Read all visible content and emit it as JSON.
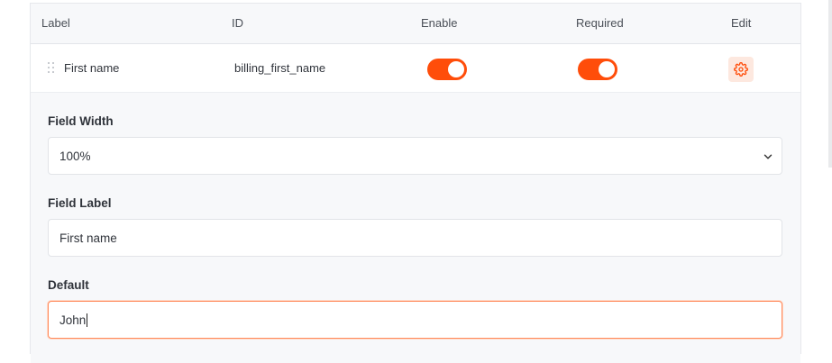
{
  "table": {
    "headers": {
      "label": "Label",
      "id": "ID",
      "enable": "Enable",
      "required": "Required",
      "edit": "Edit"
    },
    "row": {
      "label": "First name",
      "id": "billing_first_name",
      "enabled": true,
      "required": true
    }
  },
  "settings": {
    "field_width": {
      "label": "Field Width",
      "value": "100%"
    },
    "field_label": {
      "label": "Field Label",
      "value": "First name"
    },
    "default": {
      "label": "Default",
      "value": "John"
    }
  },
  "colors": {
    "accent": "#ff4d0a",
    "accent_soft": "#fde8df"
  },
  "icons": {
    "drag": "drag-handle-icon",
    "edit": "gear-icon",
    "select": "chevron-down-icon"
  }
}
